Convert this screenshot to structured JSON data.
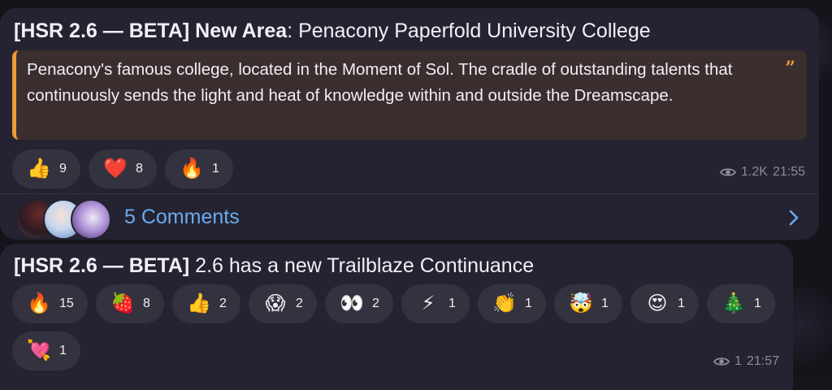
{
  "posts": [
    {
      "title_bold": "[HSR 2.6 — BETA] New Area",
      "title_rest": ": Penacony Paperfold University College",
      "quote": "Penacony's famous college, located in the Moment of Sol. The cradle of outstanding talents that continuously sends the light and heat of knowledge within and outside the Dreamscape.",
      "quote_icon": "quote-icon",
      "reactions": [
        {
          "emoji": "👍",
          "icon": "thumbs-up-icon",
          "count": "9"
        },
        {
          "emoji": "❤️",
          "icon": "heart-icon",
          "count": "8"
        },
        {
          "emoji": "🔥",
          "icon": "fire-icon",
          "count": "1"
        }
      ],
      "views": "1.2K",
      "time": "21:55",
      "comments_label": "5 Comments"
    },
    {
      "title_bold": "[HSR 2.6 — BETA]",
      "title_rest": " 2.6 has a new Trailblaze Continuance",
      "reactions": [
        {
          "emoji": "🔥",
          "icon": "fire-icon",
          "count": "15"
        },
        {
          "emoji": "🍓",
          "icon": "strawberry-icon",
          "count": "8"
        },
        {
          "emoji": "👍",
          "icon": "thumbs-up-icon",
          "count": "2"
        },
        {
          "emoji": "😱",
          "icon": "screaming-face-icon",
          "count": "2"
        },
        {
          "emoji": "👀",
          "icon": "eyes-icon",
          "count": "2"
        },
        {
          "emoji": "⚡",
          "icon": "lightning-icon",
          "count": "1"
        },
        {
          "emoji": "👏",
          "icon": "clapping-hands-icon",
          "count": "1"
        },
        {
          "emoji": "🤯",
          "icon": "exploding-head-icon",
          "count": "1"
        },
        {
          "emoji": "😍",
          "icon": "heart-eyes-icon",
          "count": "1"
        },
        {
          "emoji": "🎄",
          "icon": "christmas-tree-icon",
          "count": "1"
        },
        {
          "emoji": "💘",
          "icon": "heart-arrow-icon",
          "count": "1"
        }
      ],
      "views": "1",
      "time": "21:57"
    }
  ],
  "colors": {
    "bubble": "#252331",
    "quote_bg": "#3a2e2f",
    "quote_accent": "#f09a3a",
    "link": "#6aaaf0",
    "meta": "#8d8a99"
  }
}
